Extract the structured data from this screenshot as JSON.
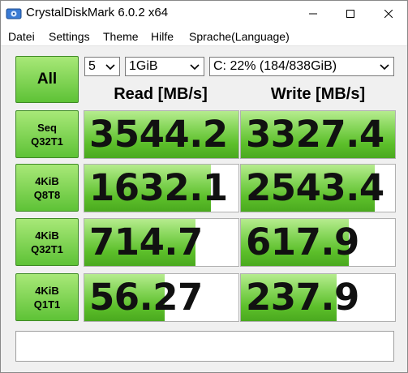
{
  "window": {
    "title": "CrystalDiskMark 6.0.2 x64"
  },
  "menu": [
    "Datei",
    "Settings",
    "Theme",
    "Hilfe",
    "Sprache(Language)"
  ],
  "controls": {
    "all_label": "All",
    "count": "5",
    "size": "1GiB",
    "drive": "C: 22% (184/838GiB)"
  },
  "headers": {
    "read": "Read [MB/s]",
    "write": "Write [MB/s]"
  },
  "tests": [
    {
      "line1": "Seq",
      "line2": "Q32T1",
      "read": "3544.2",
      "write": "3327.4",
      "read_fill": 1.0,
      "write_fill": 1.0
    },
    {
      "line1": "4KiB",
      "line2": "Q8T8",
      "read": "1632.1",
      "write": "2543.4",
      "read_fill": 0.82,
      "write_fill": 0.87
    },
    {
      "line1": "4KiB",
      "line2": "Q32T1",
      "read": "714.7",
      "write": "617.9",
      "read_fill": 0.72,
      "write_fill": 0.7
    },
    {
      "line1": "4KiB",
      "line2": "Q1T1",
      "read": "56.27",
      "write": "237.9",
      "read_fill": 0.52,
      "write_fill": 0.62
    }
  ],
  "comment": "",
  "colors": {
    "accent_green": "#5ec236",
    "bar_green": "#86d65a"
  }
}
